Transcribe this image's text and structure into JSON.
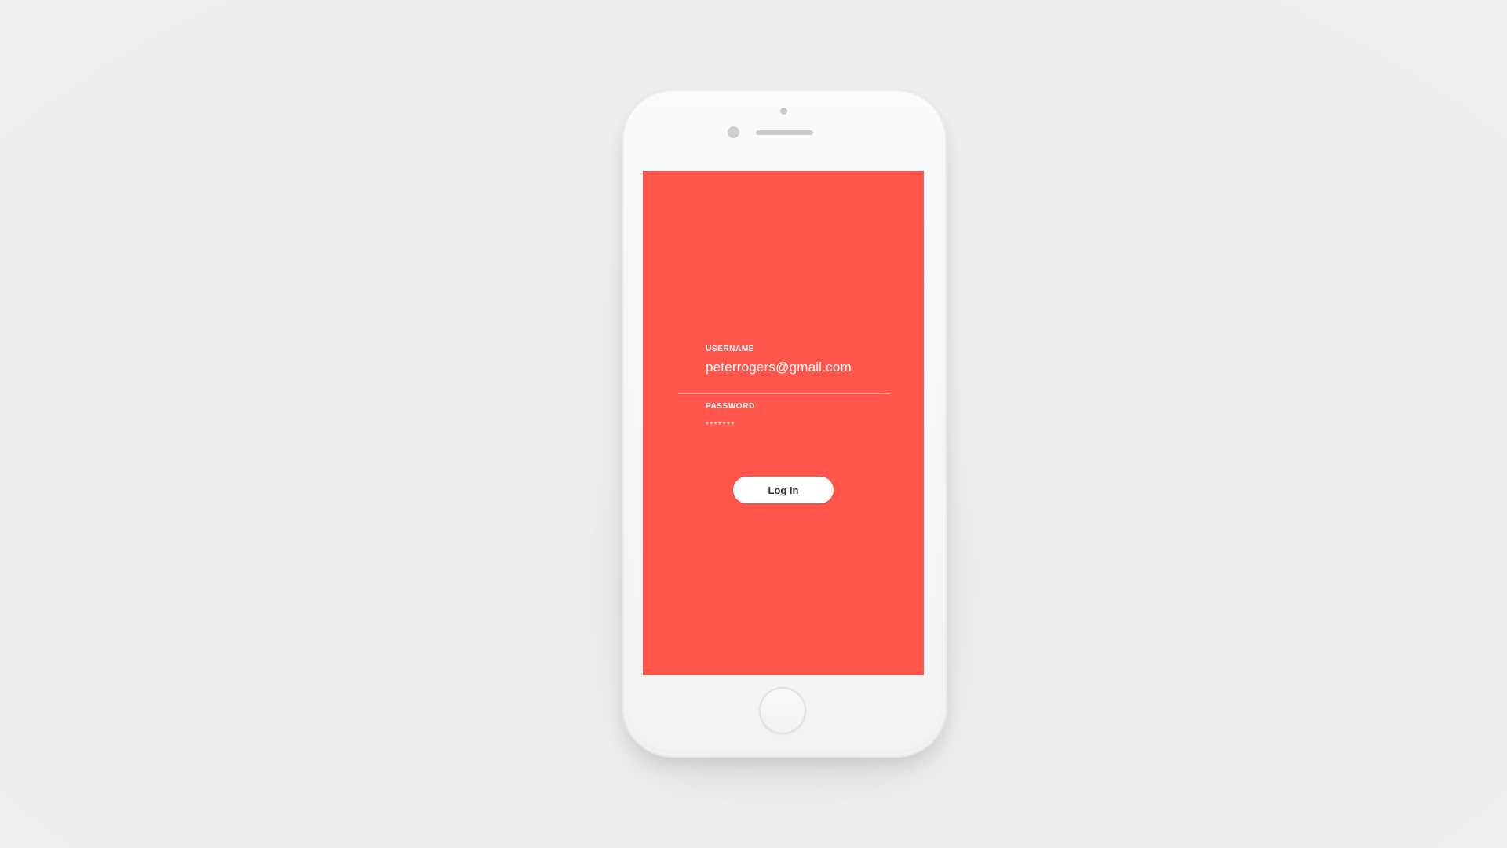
{
  "screen": {
    "background_color": "#ff554b",
    "username": {
      "label": "USERNAME",
      "value": "peterrogers@gmail.com"
    },
    "password": {
      "label": "PASSWORD",
      "value": "*******"
    },
    "login_button": {
      "label": "Log In"
    }
  },
  "device": {
    "icons": [
      "front-camera-icon",
      "earpiece-icon",
      "sensor-icon",
      "home-button-icon"
    ]
  }
}
